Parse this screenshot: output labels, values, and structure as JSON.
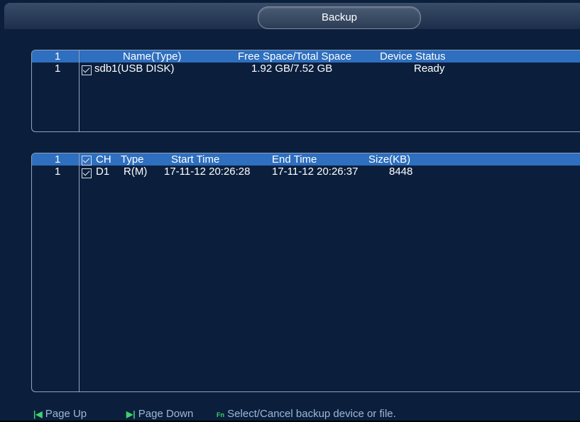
{
  "window": {
    "title": "Backup"
  },
  "devices": {
    "header": {
      "index": "1",
      "name": "Name(Type)",
      "space": "Free Space/Total Space",
      "status": "Device Status"
    },
    "rows": [
      {
        "index": "1",
        "checked": true,
        "name": "sdb1(USB DISK)",
        "space": "1.92 GB/7.52 GB",
        "status": "Ready"
      }
    ]
  },
  "files": {
    "header": {
      "index": "1",
      "checked": true,
      "ch": "CH",
      "type": "Type",
      "start": "Start Time",
      "end": "End Time",
      "size": "Size(KB)"
    },
    "rows": [
      {
        "index": "1",
        "checked": true,
        "ch": "D1",
        "type": "R(M)",
        "start": "17-11-12 20:26:28",
        "end": "17-11-12 20:26:37",
        "size": "8448"
      }
    ]
  },
  "footer": {
    "page_up_icon": "page-up-icon",
    "page_up": "Page Up",
    "page_down_icon": "page-down-icon",
    "page_down": "Page Down",
    "fn_icon": "Fn",
    "fn_text": "Select/Cancel backup device or file."
  },
  "colors": {
    "header_bg": "#2e6fbf",
    "panel_bg": "#0b1f3d",
    "accent_green": "#3fd26a"
  }
}
